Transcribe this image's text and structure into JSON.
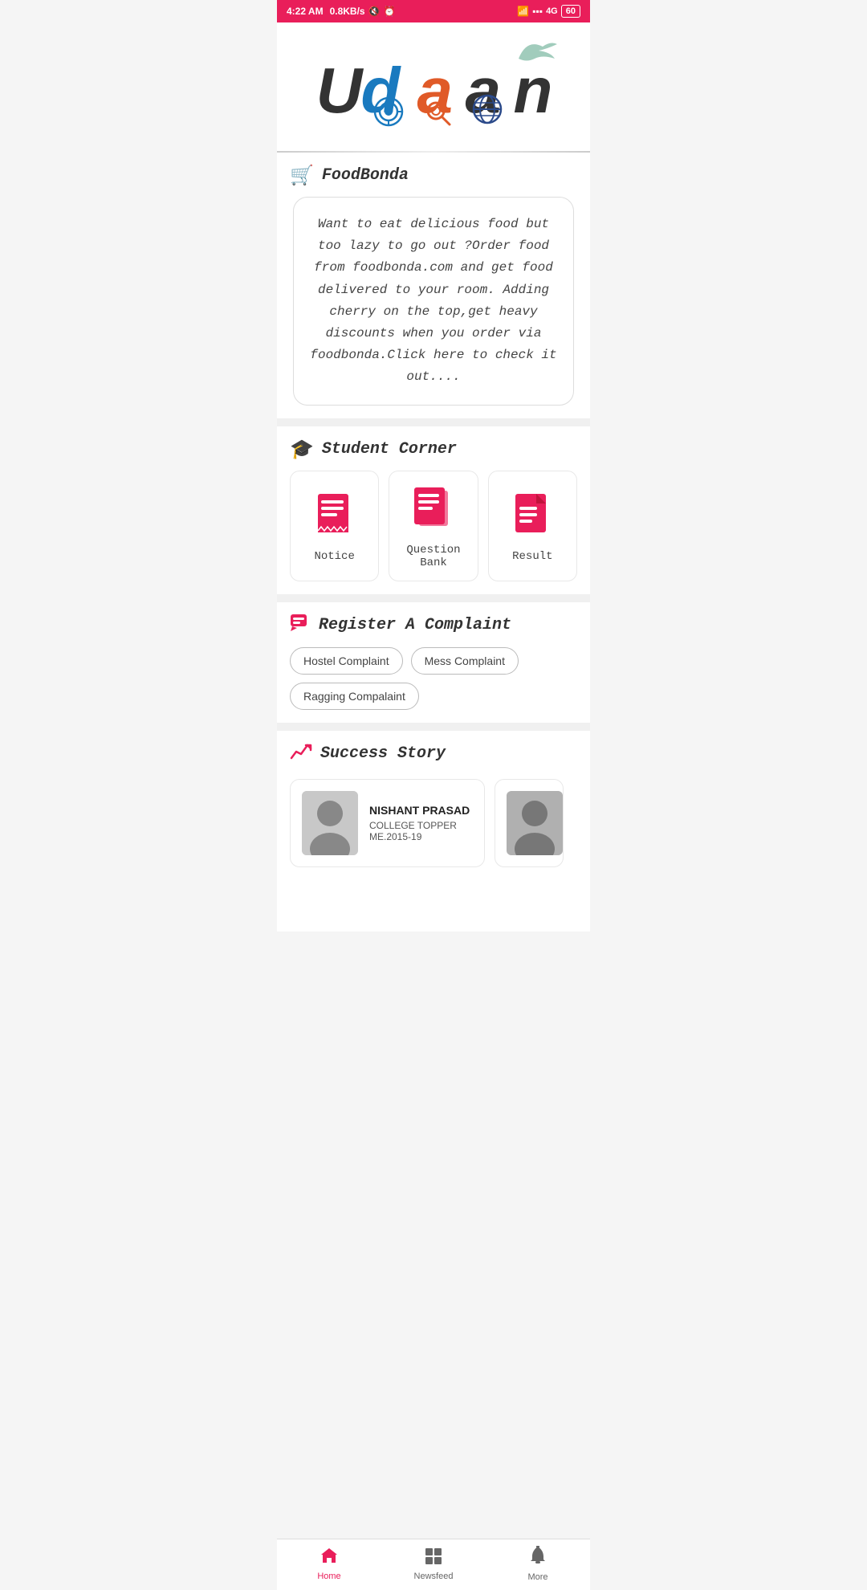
{
  "statusBar": {
    "time": "4:22 AM",
    "data": "0.8KB/s",
    "network": "4G",
    "battery": "60"
  },
  "app": {
    "name": "Udaan"
  },
  "foodBonda": {
    "sectionTitle": "FoodBonda",
    "description": "Want to eat delicious food but too lazy to go out ?Order food from foodbonda.com and get food delivered to your room. Adding cherry on the top,get heavy discounts when you order via foodbonda.Click here to check it out...."
  },
  "studentCorner": {
    "sectionTitle": "Student Corner",
    "items": [
      {
        "label": "Notice",
        "icon": "notice"
      },
      {
        "label": "Question Bank",
        "icon": "questionbank"
      },
      {
        "label": "Result",
        "icon": "result"
      }
    ]
  },
  "complaint": {
    "sectionTitle": "Register A Complaint",
    "chips": [
      {
        "label": "Hostel Complaint"
      },
      {
        "label": "Mess Complaint"
      },
      {
        "label": "Ragging Compalaint"
      }
    ]
  },
  "successStory": {
    "sectionTitle": "Success Story",
    "stories": [
      {
        "name": "NISHANT PRASAD",
        "role": "COLLEGE TOPPER",
        "year": "ME.2015-19"
      },
      {
        "name": "",
        "role": "",
        "year": ""
      }
    ]
  },
  "bottomNav": {
    "items": [
      {
        "label": "Home",
        "icon": "home",
        "active": true
      },
      {
        "label": "Newsfeed",
        "icon": "newsfeed",
        "active": false
      },
      {
        "label": "More",
        "icon": "more",
        "active": false
      }
    ]
  }
}
